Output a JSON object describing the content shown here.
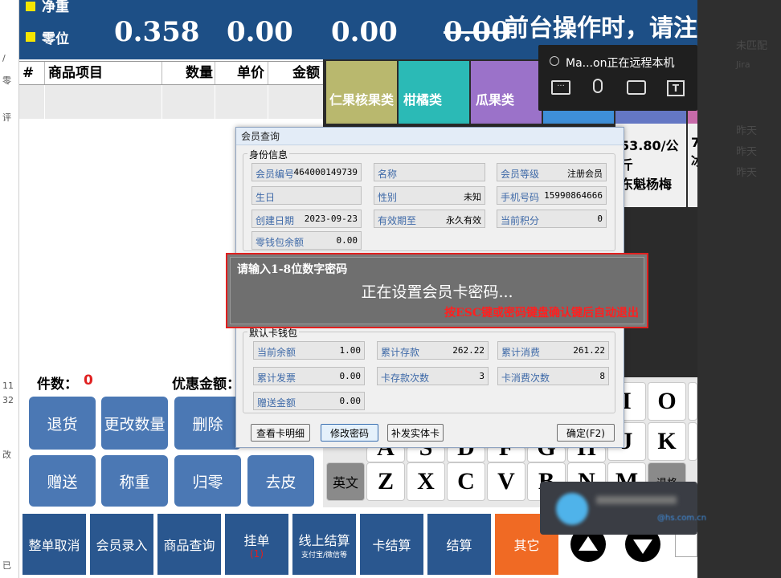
{
  "left_strip": [
    "/",
    "零",
    "评",
    "11",
    "32",
    "改",
    "已"
  ],
  "right_strip": {
    "items": [
      "未匹配",
      "Jira",
      "昨天",
      "昨天",
      "昨天"
    ]
  },
  "topbar": {
    "net_weight_label": "净重",
    "zero_label": "零位",
    "weight": "0.358",
    "value2": "0.00",
    "value3": "0.00",
    "value4_struck": "0.00",
    "marquee": "前台操作时，请注"
  },
  "table": {
    "headers": [
      "#",
      "商品项目",
      "数量",
      "单价",
      "金额"
    ]
  },
  "categories": [
    {
      "label": "仁果核果类",
      "color": "#b9b86e"
    },
    {
      "label": "柑橘类",
      "color": "#2bbab6"
    },
    {
      "label": "瓜果类",
      "color": "#9b72c9"
    }
  ],
  "products": [
    {
      "name": "53.80/公斤\n东魁杨梅"
    },
    {
      "name": "7\n冰"
    }
  ],
  "remote_banner": {
    "text": "Ma...on正在远程本机"
  },
  "counts": {
    "item_count_label": "件数：",
    "item_count": "0",
    "discount_label": "优惠金额："
  },
  "action_buttons": [
    "退货",
    "更改数量",
    "删除",
    "赠送",
    "称重",
    "归零",
    "去皮"
  ],
  "bottom_buttons": [
    {
      "label": "整单取消"
    },
    {
      "label": "会员录入"
    },
    {
      "label": "商品查询"
    },
    {
      "label": "挂单",
      "sub": "(1)"
    },
    {
      "label": "线上结算",
      "sub": "支付宝/微信等"
    },
    {
      "label": "卡结算"
    },
    {
      "label": "结算"
    },
    {
      "label": "其它"
    }
  ],
  "keyboard": {
    "row1": [
      "I",
      "O"
    ],
    "row2": [
      "J",
      "K"
    ],
    "row3": [
      "英文",
      "Z",
      "X",
      "C",
      "V",
      "B",
      "N",
      "M",
      "退格"
    ],
    "partial_row": [
      "A",
      "S",
      "D",
      "F",
      "G",
      "H"
    ]
  },
  "dialog": {
    "title": "会员查询",
    "identity_group": "身份信息",
    "member_no_label": "会员编号",
    "member_no": "464000149739",
    "name_label": "名称",
    "name": "",
    "level_label": "会员等级",
    "level": "注册会员",
    "birthday_label": "生日",
    "birthday": "",
    "gender_label": "性别",
    "gender": "未知",
    "phone_label": "手机号码",
    "phone": "15990864666",
    "created_label": "创建日期",
    "created": "2023-09-23",
    "valid_label": "有效期至",
    "valid": "永久有效",
    "points_label": "当前积分",
    "points": "0",
    "wallet_label": "零钱包余额",
    "wallet": "0.00",
    "card_group": "默认卡钱包",
    "balance_label": "当前余额",
    "balance": "1.00",
    "deposit_total_label": "累计存款",
    "deposit_total": "262.22",
    "spend_total_label": "累计消费",
    "spend_total": "261.22",
    "invoice_label": "累计发票",
    "invoice": "0.00",
    "deposit_count_label": "卡存款次数",
    "deposit_count": "3",
    "spend_count_label": "卡消费次数",
    "spend_count": "8",
    "gift_label": "赠送金额",
    "gift": "0.00",
    "btn_detail": "查看卡明细",
    "btn_change_pwd": "修改密码",
    "btn_issue_card": "补发实体卡",
    "btn_ok": "确定(F2)"
  },
  "password_prompt": {
    "title": "请输入1-8位数字密码",
    "message": "正在设置会员卡密码...",
    "hint": "按ESC键或密码键盘确认键后自动退出"
  },
  "blurred_popup": {
    "text": "@hs.com.cn"
  }
}
